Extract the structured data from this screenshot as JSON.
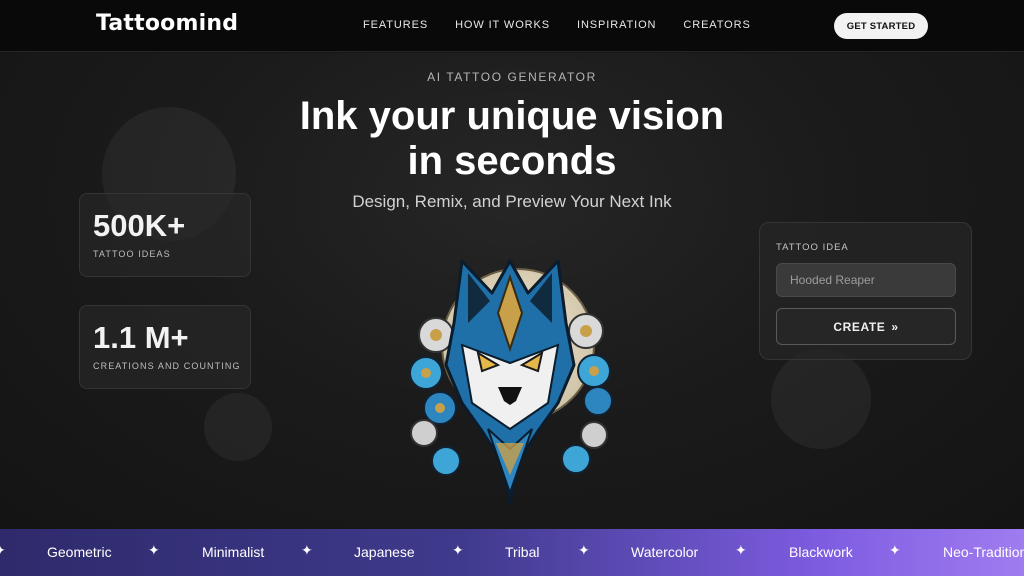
{
  "brand": {
    "logo": "Tattoomind"
  },
  "nav": {
    "items": [
      "FEATURES",
      "HOW IT WORKS",
      "INSPIRATION",
      "CREATORS"
    ],
    "cta": "GET STARTED"
  },
  "hero": {
    "eyebrow": "AI TATTOO GENERATOR",
    "title_line1": "Ink your unique vision",
    "title_line2": "in seconds",
    "subtitle": "Design, Remix, and Preview Your Next Ink"
  },
  "stats": [
    {
      "value": "500K+",
      "label": "TATTOO IDEAS"
    },
    {
      "value": "1.1 M+",
      "label": "CREATIONS AND COUNTING"
    }
  ],
  "generator": {
    "label": "TATTOO IDEA",
    "placeholder": "Hooded Reaper",
    "button": "CREATE",
    "button_icon": "»"
  },
  "marquee": {
    "separator": "✦",
    "styles": [
      "Geometric",
      "Minimalist",
      "Japanese",
      "Tribal",
      "Watercolor",
      "Blackwork",
      "Neo-Traditional"
    ]
  },
  "colors": {
    "accent_start": "#2e2a6b",
    "accent_end": "#a07cf0",
    "wolf_blue": "#2e86c1",
    "gold": "#c9a04a"
  }
}
